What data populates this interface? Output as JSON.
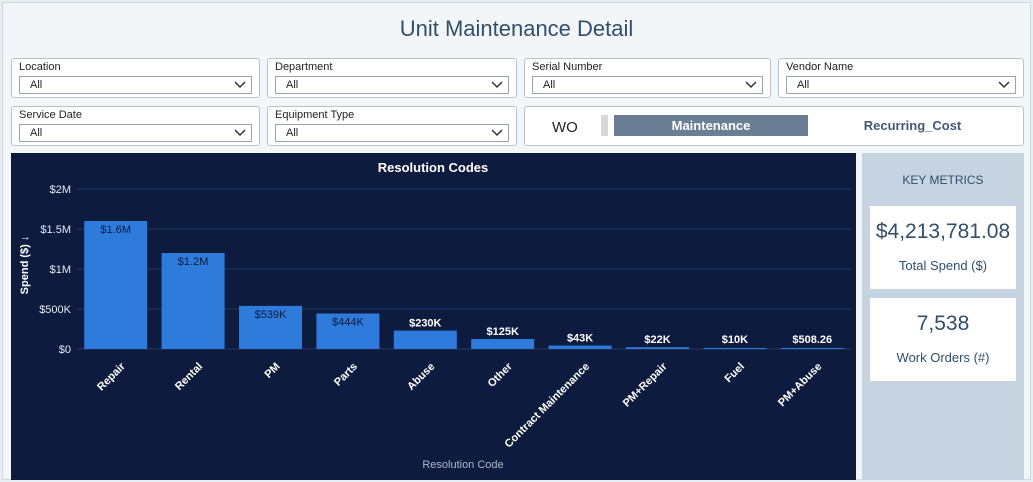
{
  "page": {
    "title": "Unit Maintenance Detail"
  },
  "filters": {
    "location": {
      "label": "Location",
      "value": "All"
    },
    "department": {
      "label": "Department",
      "value": "All"
    },
    "serial_number": {
      "label": "Serial Number",
      "value": "All"
    },
    "vendor_name": {
      "label": "Vendor Name",
      "value": "All"
    },
    "service_date": {
      "label": "Service Date",
      "value": "All"
    },
    "equipment_type": {
      "label": "Equipment Type",
      "value": "All"
    }
  },
  "toggle": {
    "wo": "WO",
    "maintenance": "Maintenance",
    "recurring": "Recurring_Cost",
    "selected": "Maintenance"
  },
  "metrics": {
    "heading": "KEY METRICS",
    "total_spend_value": "$4,213,781.08",
    "total_spend_label": "Total Spend ($)",
    "work_orders_value": "7,538",
    "work_orders_label": "Work Orders (#)"
  },
  "colors": {
    "bar": "#2f7bdc",
    "chart_bg": "#0d1b3e",
    "toggle_selected": "#6a7e96"
  },
  "chart_data": {
    "type": "bar",
    "title": "Resolution Codes",
    "xlabel": "Resolution Code",
    "ylabel": "Spend ($) ↓",
    "categories": [
      "Repair",
      "Rental",
      "PM",
      "Parts",
      "Abuse",
      "Other",
      "Contract Maintenance",
      "PM+Repair",
      "Fuel",
      "PM+Abuse"
    ],
    "values": [
      1600000,
      1200000,
      539000,
      444000,
      230000,
      125000,
      43000,
      22000,
      10000,
      508.26
    ],
    "data_labels": [
      "$1.6M",
      "$1.2M",
      "$539K",
      "$444K",
      "$230K",
      "$125K",
      "$43K",
      "$22K",
      "$10K",
      "$508.26"
    ],
    "yticks": [
      "$0",
      "$500K",
      "$1M",
      "$1.5M",
      "$2M"
    ],
    "ylim": [
      0,
      2000000
    ],
    "grid": true
  }
}
